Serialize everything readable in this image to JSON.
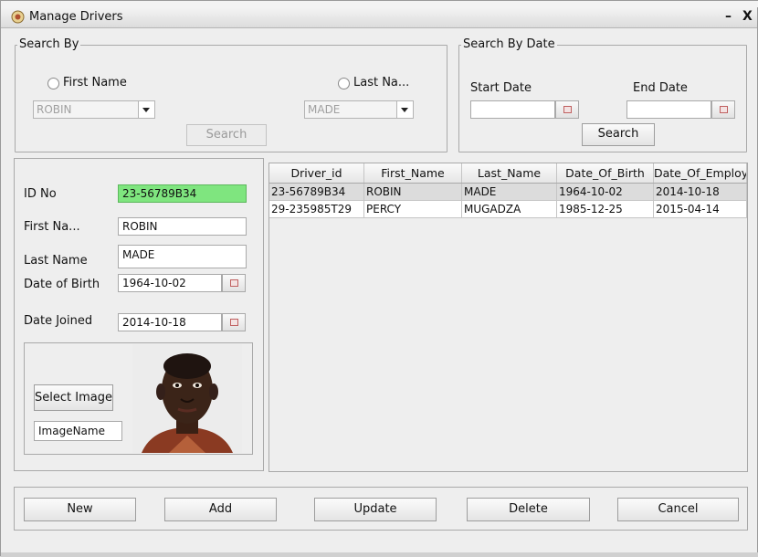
{
  "window": {
    "title": "Manage Drivers",
    "minimize": "–",
    "close": "X"
  },
  "search_by": {
    "legend": "Search By",
    "first_name_radio": "First Name",
    "last_name_radio": "Last Na...",
    "first_name_value": "ROBIN",
    "last_name_value": "MADE",
    "search_button": "Search"
  },
  "search_by_date": {
    "legend": "Search By Date",
    "start_label": "Start Date",
    "end_label": "End Date",
    "start_value": "",
    "end_value": "",
    "search_button": "Search"
  },
  "form": {
    "id_label": "ID No",
    "id_value": "23-56789B34",
    "id_highlight": "#7fe57f",
    "first_name_label": "First Na...",
    "first_name_value": "ROBIN",
    "last_name_label": "Last Name",
    "last_name_value": "MADE",
    "dob_label": "Date of Birth",
    "dob_value": "1964-10-02",
    "joined_label": "Date Joined",
    "joined_value": "2014-10-18",
    "select_image_button": "Select Image",
    "image_name_value": "ImageName"
  },
  "table": {
    "columns": [
      "Driver_id",
      "First_Name",
      "Last_Name",
      "Date_Of_Birth",
      "Date_Of_Employ"
    ],
    "rows": [
      [
        "23-56789B34",
        "ROBIN",
        "MADE",
        "1964-10-02",
        "2014-10-18"
      ],
      [
        "29-235985T29",
        "PERCY",
        "MUGADZA",
        "1985-12-25",
        "2015-04-14"
      ]
    ],
    "selected_row": 0
  },
  "buttons": {
    "new": "New",
    "add": "Add",
    "update": "Update",
    "delete": "Delete",
    "cancel": "Cancel"
  }
}
